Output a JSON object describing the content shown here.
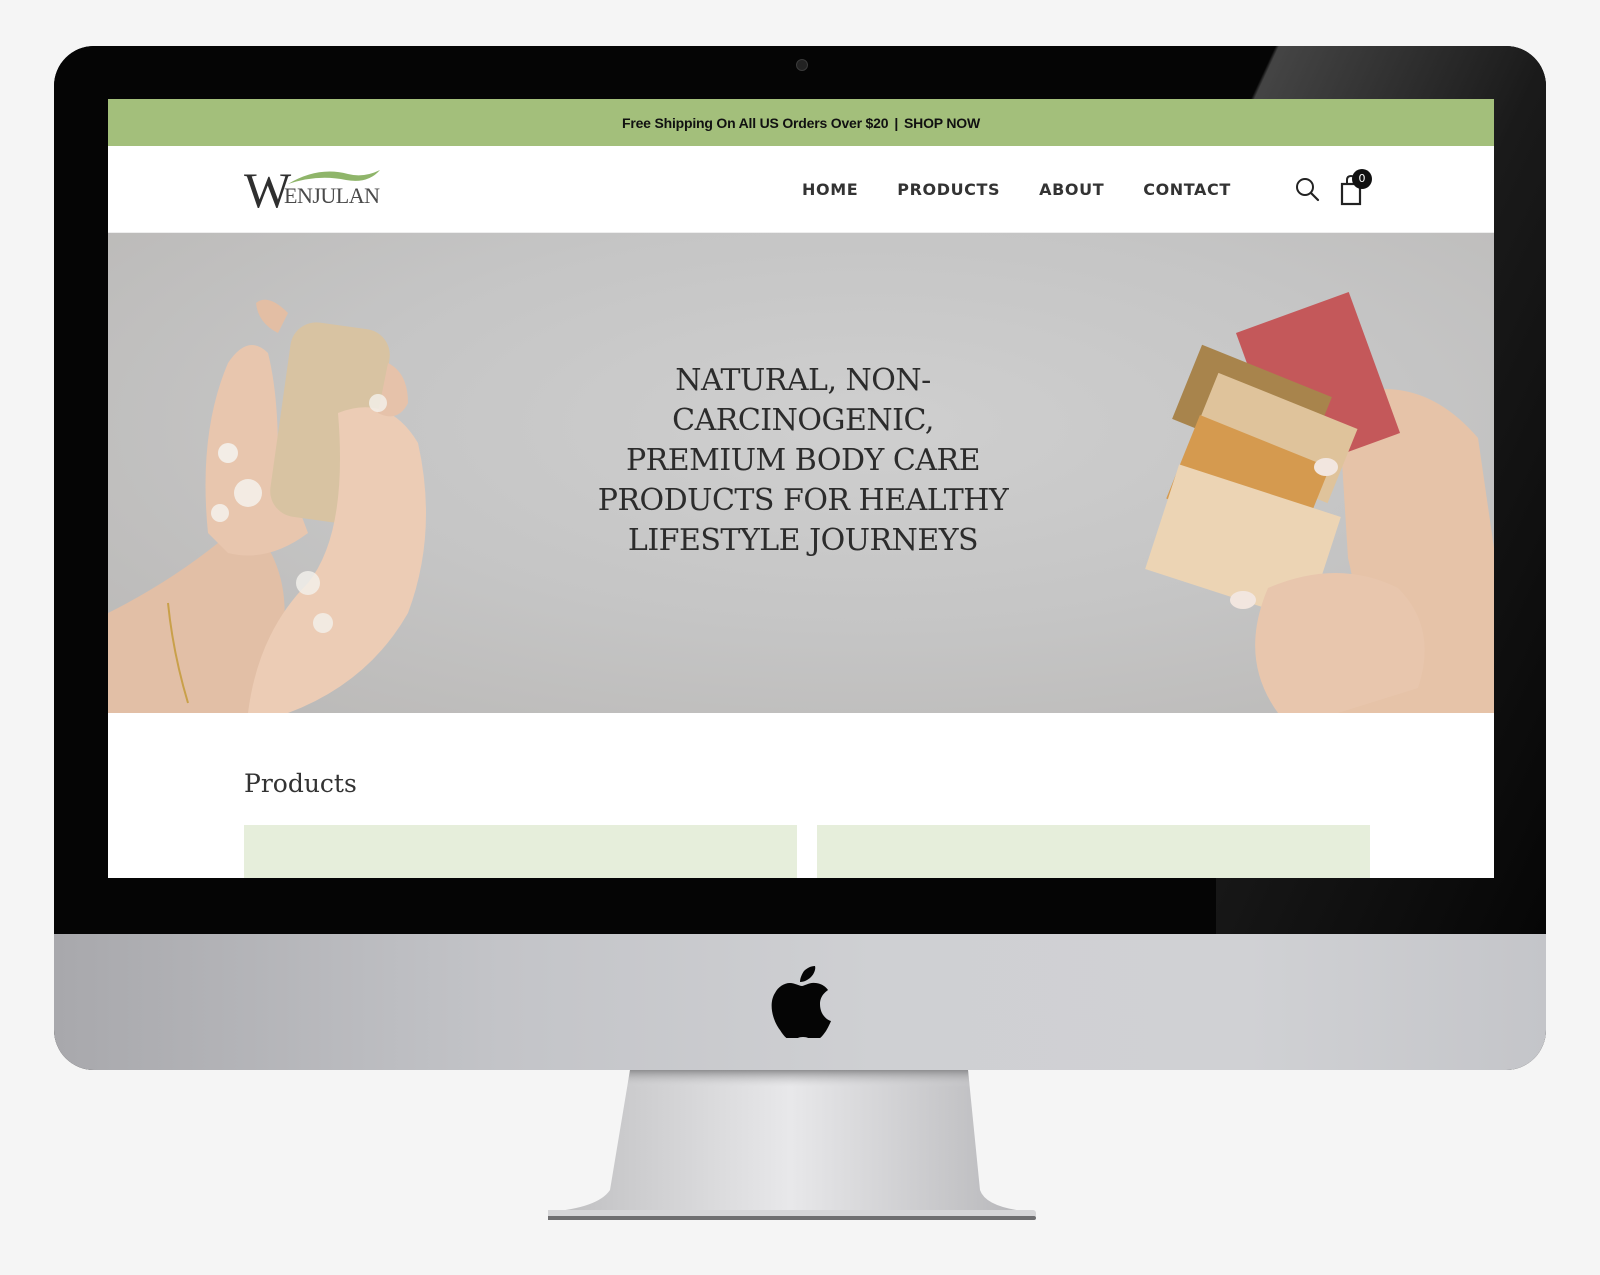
{
  "announcement": {
    "text": "Free Shipping On All US Orders Over $20",
    "separator": "|",
    "link": "SHOP NOW"
  },
  "logo": {
    "initial": "W",
    "rest": "ENJULAN"
  },
  "nav": {
    "items": [
      {
        "label": "HOME"
      },
      {
        "label": "PRODUCTS"
      },
      {
        "label": "ABOUT"
      },
      {
        "label": "CONTACT"
      }
    ]
  },
  "header_icons": {
    "search": "search-icon",
    "cart": "cart-icon",
    "cart_count": "0"
  },
  "hero": {
    "title": "NATURAL, NON-CARCINOGENIC, PREMIUM BODY CARE PRODUCTS FOR HEALTHY LIFESTYLE JOURNEYS"
  },
  "products": {
    "heading": "Products"
  },
  "colors": {
    "announcement_bg": "#a3bf7b",
    "card_bg": "#e6eedb",
    "text": "#333333"
  }
}
